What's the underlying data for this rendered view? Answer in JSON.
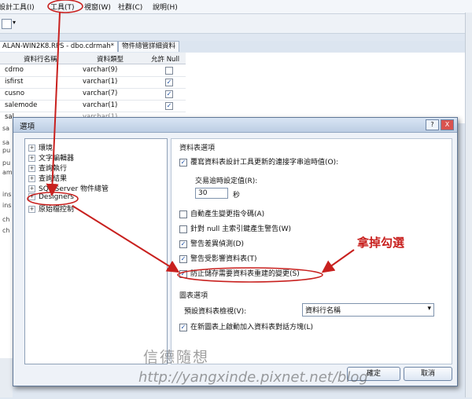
{
  "menu": {
    "items": [
      "設計工具(I)",
      "工具(T)",
      "視窗(W)",
      "社群(C)",
      "說明(H)"
    ]
  },
  "tabs": [
    {
      "label": "ALAN-WIN2K8.RPS - dbo.cdrmah*"
    },
    {
      "label": "物件總管詳細資料"
    }
  ],
  "grid": {
    "headers": [
      "資料行名稱",
      "資料類型",
      "允許 Null"
    ],
    "rows": [
      {
        "name": "cdrno",
        "type": "varchar(9)",
        "null": false
      },
      {
        "name": "isfirst",
        "type": "varchar(1)",
        "null": true
      },
      {
        "name": "cusno",
        "type": "varchar(7)",
        "null": true
      },
      {
        "name": "salemode",
        "type": "varchar(1)",
        "null": true
      },
      {
        "name": "sal",
        "type": "varchar(1)",
        "null": false
      }
    ]
  },
  "left_strip": [
    "sa",
    "sa",
    "pu",
    "pu",
    "am",
    "ins",
    "ins",
    "ch",
    "ch"
  ],
  "dialog": {
    "title": "選項",
    "help_btn": "?",
    "close_btn": "X",
    "tree": [
      {
        "label": "環境",
        "expander": "+"
      },
      {
        "label": "文字編輯器",
        "expander": "+"
      },
      {
        "label": "查詢執行",
        "expander": "+"
      },
      {
        "label": "查詢結果",
        "expander": "+"
      },
      {
        "label": "SQL Server 物件總管",
        "expander": "+"
      },
      {
        "label": "Designers",
        "expander": "+"
      },
      {
        "label": "原始檔控制",
        "expander": "+"
      }
    ],
    "section1": "資料表選項",
    "opt_override_timeout": "覆寫資料表設計工具更新的連接字串逾時值(O):",
    "timeout_label": "交易逾時設定值(R):",
    "timeout_value": "30",
    "timeout_unit": "秒",
    "opt_auto_script": "自動產生變更指令碼(A)",
    "opt_null_warning": "針對 null 主索引鍵產生警告(W)",
    "opt_diff_warning": "警告差異偵測(D)",
    "opt_affected_tables": "警告受影響資料表(T)",
    "opt_prevent_saving": "防止儲存需要資料表重建的變更(S)",
    "section2": "圖表選項",
    "default_view_label": "預設資料表檢視(V):",
    "default_view_value": "資料行名稱",
    "opt_launch_add_table": "在新圖表上啟動加入資料表對話方塊(L)",
    "ok": "確定",
    "cancel": "取消"
  },
  "annotation": "拿掉勾選",
  "watermark": {
    "name": "信德隨想",
    "url": "http://yangxinde.pixnet.net/blog"
  },
  "colors": {
    "annotation_red": "#c8201e",
    "dialog_border": "#5f7797"
  }
}
